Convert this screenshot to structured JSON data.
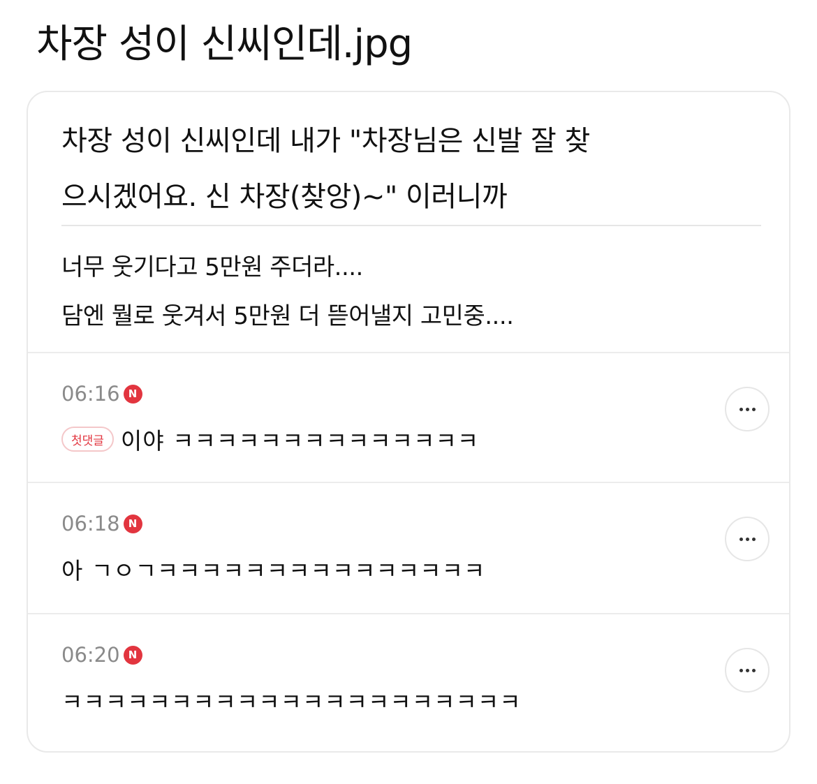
{
  "page_title": "차장 성이 신씨인데.jpg",
  "post": {
    "headline_line1": "차장 성이 신씨인데 내가 \"차장님은 신발 잘 찾",
    "headline_line2": "으시겠어요. 신 차장(찾앙)~\" 이러니까",
    "body_line1": "너무 웃기다고 5만원 주더라....",
    "body_line2": "담엔 뭘로 웃겨서 5만원 더 뜯어낼지 고민중...."
  },
  "comments": [
    {
      "time": "06:16",
      "new_badge": "N",
      "first_comment_label": "첫댓글",
      "text": "이야 ㅋㅋㅋㅋㅋㅋㅋㅋㅋㅋㅋㅋㅋㅋ"
    },
    {
      "time": "06:18",
      "new_badge": "N",
      "text": "아 ㄱㅇㄱㅋㅋㅋㅋㅋㅋㅋㅋㅋㅋㅋㅋㅋㅋㅋ"
    },
    {
      "time": "06:20",
      "new_badge": "N",
      "text": "ㅋㅋㅋㅋㅋㅋㅋㅋㅋㅋㅋㅋㅋㅋㅋㅋㅋㅋㅋㅋㅋ"
    }
  ],
  "icons": {
    "more": "more-horizontal-icon",
    "new": "new-badge-icon"
  },
  "colors": {
    "accent_red": "#e2353f",
    "timestamp_gray": "#8a8a8a",
    "border_gray": "#e9e9e9"
  }
}
